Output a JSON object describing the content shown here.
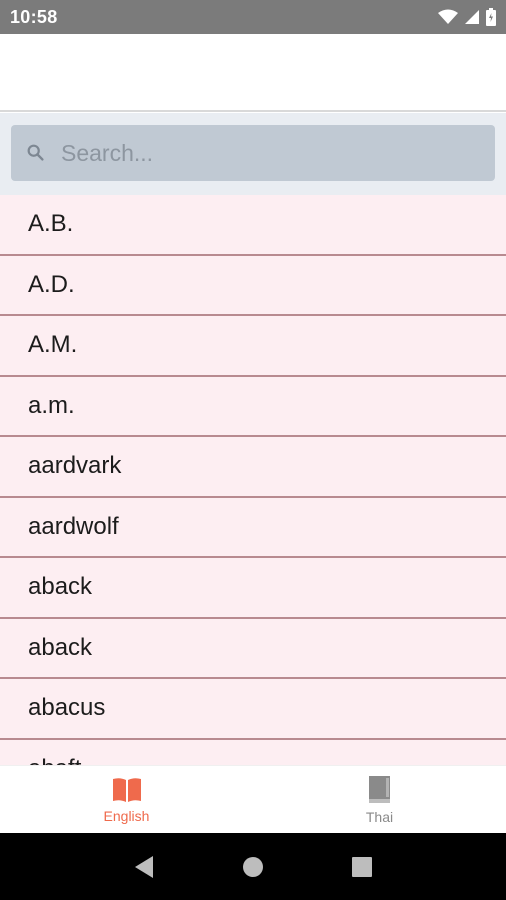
{
  "status_bar": {
    "time": "10:58",
    "icons": [
      "wifi-icon",
      "signal-icon",
      "battery-icon"
    ]
  },
  "search": {
    "placeholder": "Search...",
    "value": ""
  },
  "words": [
    "A.B.",
    "A.D.",
    "A.M.",
    "a.m.",
    "aardvark",
    "aardwolf",
    "aback",
    "aback",
    "abacus",
    "abaft"
  ],
  "bottom_nav": {
    "tabs": [
      {
        "label": "English",
        "icon": "open-book-icon",
        "active": true
      },
      {
        "label": "Thai",
        "icon": "closed-book-icon",
        "active": false
      }
    ]
  },
  "colors": {
    "accent": "#ef6a4c",
    "list_background": "#fdeef2",
    "divider": "#b88a90",
    "search_box": "#c0c9d3"
  }
}
